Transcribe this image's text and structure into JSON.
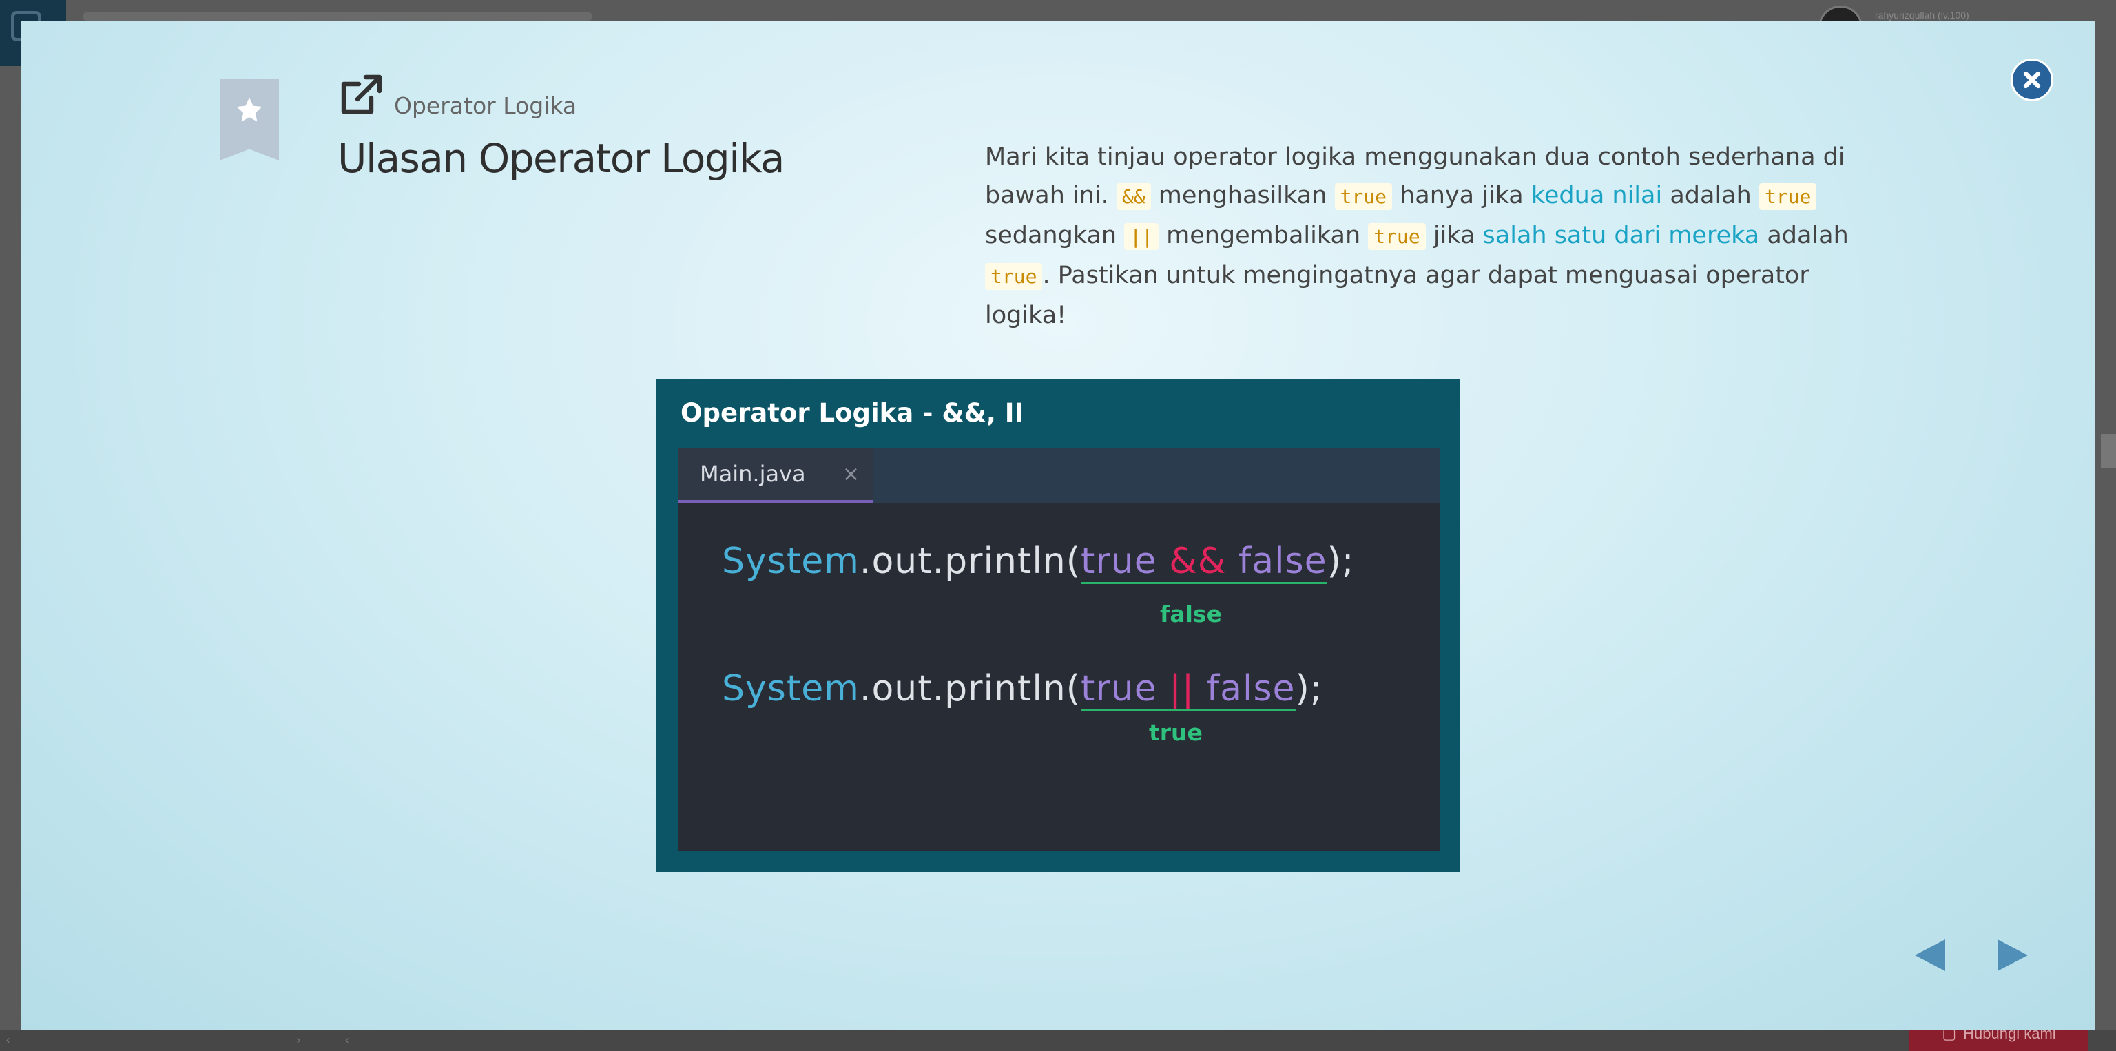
{
  "background": {
    "username": "rahyurizqullah (lv.100)",
    "contact_label": "Hubungi kami"
  },
  "modal": {
    "category": "Operator Logika",
    "title": "Ulasan Operator Logika",
    "description": {
      "t1": "Mari kita tinjau operator logika menggunakan dua contoh sederhana di bawah ini. ",
      "code_and": "&&",
      "t2": " menghasilkan ",
      "code_true1": "true",
      "t3": " hanya jika ",
      "hl_both": "kedua nilai",
      "t4": " adalah ",
      "code_true2": "true",
      "t5": " sedangkan ",
      "code_or": "||",
      "t6": " mengembalikan ",
      "code_true3": "true",
      "t7": " jika ",
      "hl_either": "salah satu dari mereka",
      "t8": " adalah ",
      "code_true4": "true",
      "t9": ". Pastikan untuk mengingatnya agar dapat menguasai operator logika!"
    },
    "slide": {
      "title": "Operator Logika -  &&, II",
      "tab_label": "Main.java",
      "tab_close": "×",
      "line1": {
        "sys": "System",
        "mid": ".out.println(",
        "kw1": "true",
        "op": "&&",
        "kw2": "false",
        "end": ");"
      },
      "result1": "false",
      "line2": {
        "sys": "System",
        "mid": ".out.println(",
        "kw1": "true",
        "op": "||",
        "kw2": "false",
        "end": ");"
      },
      "result2": "true"
    }
  },
  "icons": {
    "bookmark": "star-bookmark-icon",
    "external": "external-link-icon",
    "close": "close-icon",
    "prev": "arrow-left-icon",
    "next": "arrow-right-icon"
  },
  "colors": {
    "accent_blue": "#28629a",
    "highlight": "#1aa3c4",
    "code_bg": "#fffbe6",
    "code_text": "#c98a00",
    "slide_frame": "#0b5566",
    "editor_bg": "#282c34"
  }
}
